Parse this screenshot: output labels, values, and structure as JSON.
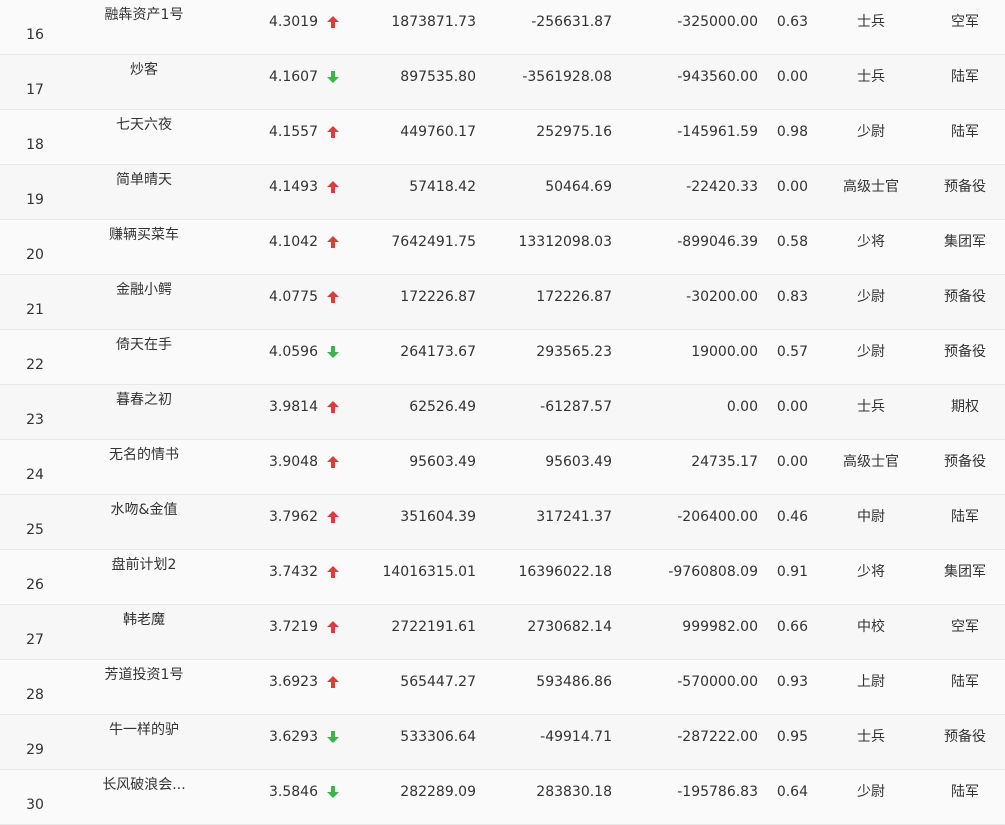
{
  "colors": {
    "up": "#e03a3a",
    "down": "#39b54a"
  },
  "rows": [
    {
      "rank": "16",
      "name": "融犇资产1号",
      "score": "4.3019",
      "trend": "up",
      "v1": "1873871.73",
      "v2": "-256631.87",
      "v3": "-325000.00",
      "ratio": "0.63",
      "level": "士兵",
      "army": "空军"
    },
    {
      "rank": "17",
      "name": "炒客",
      "score": "4.1607",
      "trend": "down",
      "v1": "897535.80",
      "v2": "-3561928.08",
      "v3": "-943560.00",
      "ratio": "0.00",
      "level": "士兵",
      "army": "陆军"
    },
    {
      "rank": "18",
      "name": "七天六夜",
      "score": "4.1557",
      "trend": "up",
      "v1": "449760.17",
      "v2": "252975.16",
      "v3": "-145961.59",
      "ratio": "0.98",
      "level": "少尉",
      "army": "陆军"
    },
    {
      "rank": "19",
      "name": "简单晴天",
      "score": "4.1493",
      "trend": "up",
      "v1": "57418.42",
      "v2": "50464.69",
      "v3": "-22420.33",
      "ratio": "0.00",
      "level": "高级士官",
      "army": "预备役"
    },
    {
      "rank": "20",
      "name": "赚辆买菜车",
      "score": "4.1042",
      "trend": "up",
      "v1": "7642491.75",
      "v2": "13312098.03",
      "v3": "-899046.39",
      "ratio": "0.58",
      "level": "少将",
      "army": "集团军"
    },
    {
      "rank": "21",
      "name": "金融小鳄",
      "score": "4.0775",
      "trend": "up",
      "v1": "172226.87",
      "v2": "172226.87",
      "v3": "-30200.00",
      "ratio": "0.83",
      "level": "少尉",
      "army": "预备役"
    },
    {
      "rank": "22",
      "name": "倚天在手",
      "score": "4.0596",
      "trend": "down",
      "v1": "264173.67",
      "v2": "293565.23",
      "v3": "19000.00",
      "ratio": "0.57",
      "level": "少尉",
      "army": "预备役"
    },
    {
      "rank": "23",
      "name": "暮春之初",
      "score": "3.9814",
      "trend": "up",
      "v1": "62526.49",
      "v2": "-61287.57",
      "v3": "0.00",
      "ratio": "0.00",
      "level": "士兵",
      "army": "期权"
    },
    {
      "rank": "24",
      "name": "无名的情书",
      "score": "3.9048",
      "trend": "up",
      "v1": "95603.49",
      "v2": "95603.49",
      "v3": "24735.17",
      "ratio": "0.00",
      "level": "高级士官",
      "army": "预备役"
    },
    {
      "rank": "25",
      "name": "水吻&金值",
      "score": "3.7962",
      "trend": "up",
      "v1": "351604.39",
      "v2": "317241.37",
      "v3": "-206400.00",
      "ratio": "0.46",
      "level": "中尉",
      "army": "陆军"
    },
    {
      "rank": "26",
      "name": "盘前计划2",
      "score": "3.7432",
      "trend": "up",
      "v1": "14016315.01",
      "v2": "16396022.18",
      "v3": "-9760808.09",
      "ratio": "0.91",
      "level": "少将",
      "army": "集团军"
    },
    {
      "rank": "27",
      "name": "韩老魔",
      "score": "3.7219",
      "trend": "up",
      "v1": "2722191.61",
      "v2": "2730682.14",
      "v3": "999982.00",
      "ratio": "0.66",
      "level": "中校",
      "army": "空军"
    },
    {
      "rank": "28",
      "name": "芳道投资1号",
      "score": "3.6923",
      "trend": "up",
      "v1": "565447.27",
      "v2": "593486.86",
      "v3": "-570000.00",
      "ratio": "0.93",
      "level": "上尉",
      "army": "陆军"
    },
    {
      "rank": "29",
      "name": "牛一样的驴",
      "score": "3.6293",
      "trend": "down",
      "v1": "533306.64",
      "v2": "-49914.71",
      "v3": "-287222.00",
      "ratio": "0.95",
      "level": "士兵",
      "army": "预备役"
    },
    {
      "rank": "30",
      "name": "长风破浪会...",
      "score": "3.5846",
      "trend": "down",
      "v1": "282289.09",
      "v2": "283830.18",
      "v3": "-195786.83",
      "ratio": "0.64",
      "level": "少尉",
      "army": "陆军"
    }
  ]
}
